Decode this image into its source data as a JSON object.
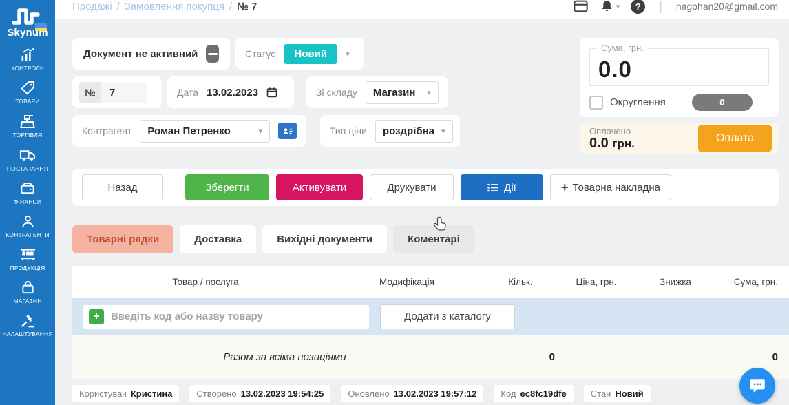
{
  "app": {
    "brand": "Skynum"
  },
  "icons": {
    "caret_down": "▾",
    "slash": "/",
    "plus": "+",
    "divider": "|",
    "help": "?"
  },
  "header": {
    "breadcrumb": {
      "sales": "Продажі",
      "order": "Замовлення покупця",
      "current": "№ 7"
    },
    "user_email": "nagohan20@gmail.com"
  },
  "sidebar": {
    "items": [
      {
        "label": "КОНТРОЛЬ",
        "icon": "chart-growth-icon"
      },
      {
        "label": "ТОВАРИ",
        "icon": "tag-icon"
      },
      {
        "label": "ТОРГІВЛЯ",
        "icon": "cash-register-icon"
      },
      {
        "label": "ПОСТАЧАННЯ",
        "icon": "truck-icon"
      },
      {
        "label": "ФІНАНСИ",
        "icon": "wallet-icon"
      },
      {
        "label": "КОНТРАГЕНТИ",
        "icon": "person-icon"
      },
      {
        "label": "ПРОДУКЦІЯ",
        "icon": "production-icon"
      },
      {
        "label": "МАГАЗИН",
        "icon": "shop-icon"
      },
      {
        "label": "НАЛАШТУВАННЯ",
        "icon": "settings-icon"
      }
    ]
  },
  "document": {
    "active_toggle_label": "Документ не активний",
    "status_label": "Статус",
    "status_value": "Новий",
    "number_label": "№",
    "number_value": "7",
    "date_label": "Дата",
    "date_value": "13.02.2023",
    "warehouse_label": "Зі складу",
    "warehouse_value": "Магазин",
    "counterparty_label": "Контрагент",
    "counterparty_value": "Роман Петренко",
    "price_type_label": "Тип ціни",
    "price_type_value": "роздрібна"
  },
  "summary": {
    "total_label": "Сума, грн.",
    "total_value": "0.0",
    "rounding_label": "Округлення",
    "rounding_value": "0",
    "paid_label": "Оплачено",
    "paid_value": "0.0",
    "paid_currency": "грн.",
    "pay_button": "Оплата"
  },
  "actions": {
    "back": "Назад",
    "save": "Зберегти",
    "activate": "Активувати",
    "print": "Друкувати",
    "actions_menu": "Дії",
    "goods_invoice": "Товарна накладна"
  },
  "tabs": [
    {
      "label": "Товарні рядки",
      "active": true
    },
    {
      "label": "Доставка",
      "active": false
    },
    {
      "label": "Вихідні документи",
      "active": false
    },
    {
      "label": "Коментарі",
      "active": false
    }
  ],
  "table": {
    "columns": [
      "Товар / послуга",
      "Модифікація",
      "Кільк.",
      "Ціна, грн.",
      "Знижка",
      "Сума, грн."
    ],
    "add_input_placeholder": "Введіть код або назву товару",
    "add_from_catalog": "Додати з каталогу",
    "totals": {
      "label": "Разом за всіма позиціями",
      "qty": "0",
      "sum": "0"
    }
  },
  "footer": {
    "chips": [
      {
        "label": "Користувач",
        "value": "Кристина"
      },
      {
        "label": "Створено",
        "value": "13.02.2023 19:54:25"
      },
      {
        "label": "Оновлено",
        "value": "13.02.2023 19:57:12"
      },
      {
        "label": "Код",
        "value": "ec8fc19dfe"
      },
      {
        "label": "Стан",
        "value": "Новий"
      }
    ]
  },
  "colors": {
    "sidebar_blue": "#1c76c0",
    "status_teal": "#18c3c6",
    "save_green": "#4fb54a",
    "activate_magenta": "#d61460",
    "actions_blue": "#1d6fc3",
    "pay_orange": "#f4a41c",
    "active_tab_salmon": "#f4b2a0",
    "add_row_blue": "#d5e5f4",
    "chat_fab_blue": "#2590f2"
  }
}
